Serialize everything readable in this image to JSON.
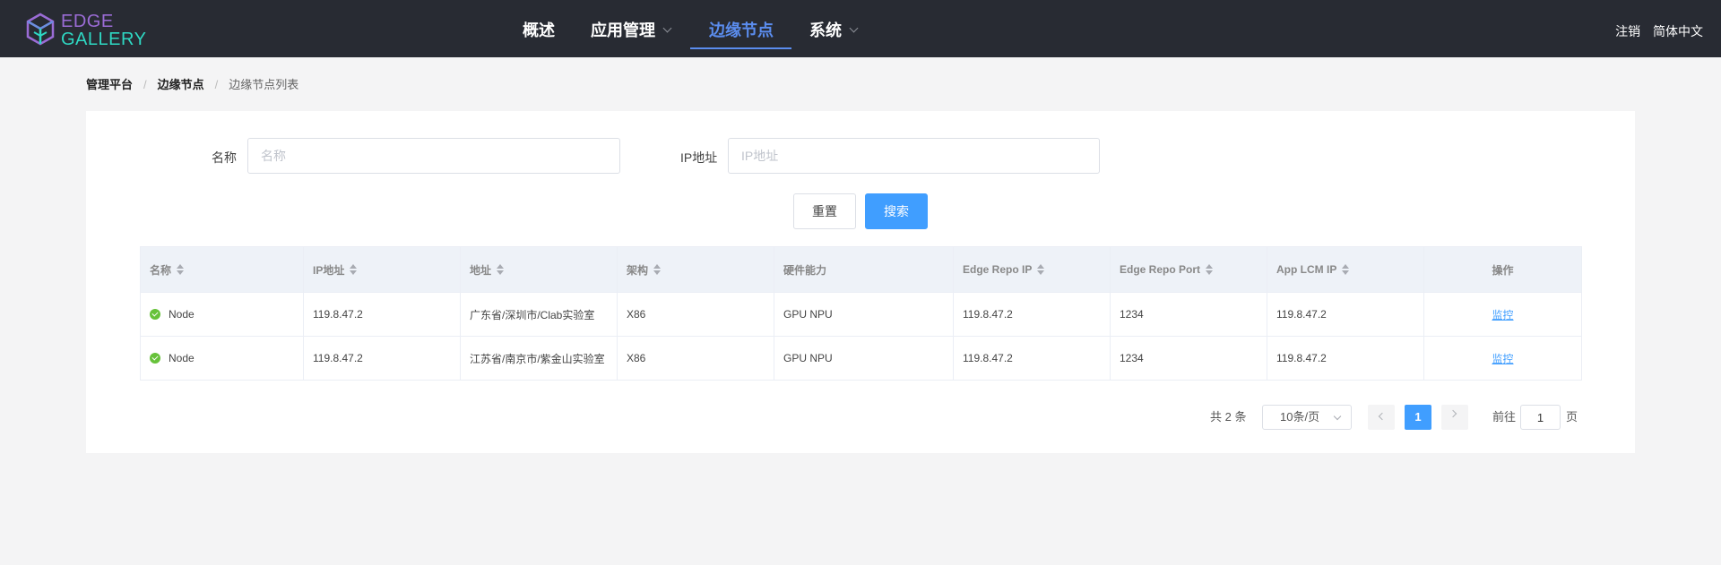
{
  "brand": {
    "line1": "EDGE",
    "line2": "GALLERY"
  },
  "nav": [
    {
      "label": "概述",
      "dropdown": false,
      "active": false
    },
    {
      "label": "应用管理",
      "dropdown": true,
      "active": false
    },
    {
      "label": "边缘节点",
      "dropdown": false,
      "active": true
    },
    {
      "label": "系统",
      "dropdown": true,
      "active": false
    }
  ],
  "top_right": {
    "logout": "注销",
    "language": "简体中文"
  },
  "breadcrumb": [
    "管理平台",
    "边缘节点",
    "边缘节点列表"
  ],
  "filters": {
    "name_label": "名称",
    "name_placeholder": "名称",
    "ip_label": "IP地址",
    "ip_placeholder": "IP地址",
    "reset": "重置",
    "search": "搜索"
  },
  "table": {
    "headers": [
      "名称",
      "IP地址",
      "地址",
      "架构",
      "硬件能力",
      "Edge Repo IP",
      "Edge Repo Port",
      "App LCM IP",
      "操作"
    ],
    "rows": [
      {
        "name": "Node",
        "ip": "119.8.47.2",
        "address": "广东省/深圳市/Clab实验室",
        "arch": "X86",
        "hardware": "GPU NPU",
        "repo_ip": "119.8.47.2",
        "repo_port": "1234",
        "lcm_ip": "119.8.47.2",
        "action": "监控"
      },
      {
        "name": "Node",
        "ip": "119.8.47.2",
        "address": "江苏省/南京市/紫金山实验室",
        "arch": "X86",
        "hardware": "GPU NPU",
        "repo_ip": "119.8.47.2",
        "repo_port": "1234",
        "lcm_ip": "119.8.47.2",
        "action": "监控"
      }
    ]
  },
  "pagination": {
    "total": "共 2 条",
    "page_size": "10条/页",
    "current_page": "1",
    "goto_prefix": "前往",
    "goto_value": "1",
    "goto_suffix": "页"
  },
  "colors": {
    "topbar": "#282b33",
    "accent": "#409eff",
    "nav_active": "#5b8def",
    "status_ok": "#67c23a"
  }
}
